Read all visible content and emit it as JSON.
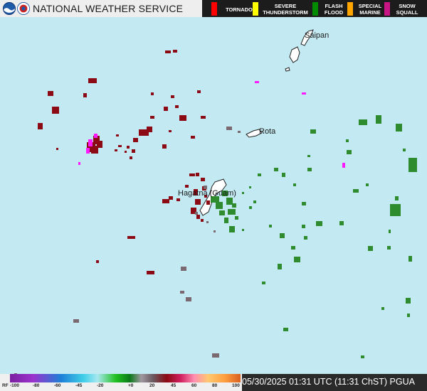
{
  "header": {
    "title": "NATIONAL WEATHER SERVICE",
    "logos": [
      "noaa-logo-icon",
      "nws-logo-icon"
    ],
    "warnings": [
      {
        "label": "TORNADO",
        "color": "#ff0000"
      },
      {
        "label": "SEVERE THUNDERSTORM",
        "color": "#ffff00"
      },
      {
        "label": "FLASH FLOOD",
        "color": "#008b00"
      },
      {
        "label": "SPECIAL MARINE",
        "color": "#ffa500"
      },
      {
        "label": "SNOW SQUALL",
        "color": "#c71585"
      }
    ]
  },
  "map": {
    "places": [
      "Saipan",
      "Rota",
      "Hagatna (Guam)"
    ],
    "echo_colors": {
      "rain": "#2e8b2e",
      "reflectivity_low": "#8b0a14",
      "mix": "#ff00ff",
      "debris": "#7a6a70"
    }
  },
  "legend": {
    "ticks": [
      "RF",
      "-100",
      "-80",
      "-60",
      "-45",
      "-20",
      "+0",
      "20",
      "45",
      "60",
      "80",
      "100"
    ]
  },
  "footer": {
    "timestamp": "05/30/2025 01:31 UTC (11:31 ChST) PGUA"
  }
}
